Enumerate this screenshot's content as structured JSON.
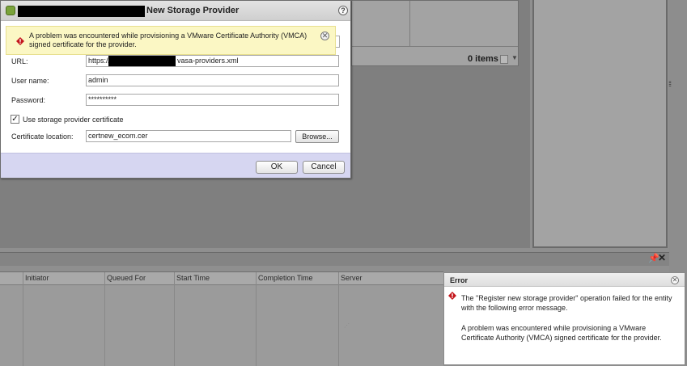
{
  "dialog": {
    "title": "New Storage Provider",
    "help_icon": "help-icon",
    "banner": {
      "icon": "error-icon",
      "message": "A problem was encountered while provisioning a VMware Certificate Authority (VMCA) signed certificate for the provider."
    },
    "form": {
      "url_label": "URL:",
      "url_prefix": "https://",
      "url_suffix": "vasa-providers.xml",
      "username_label": "User name:",
      "username_value": "admin",
      "password_label": "Password:",
      "password_value": "**********",
      "use_cert_label": "Use storage provider certificate",
      "use_cert_checked": true,
      "cert_location_label": "Certificate location:",
      "cert_location_value": "certnew_ecom.cer",
      "browse_label": "Browse..."
    },
    "ok_label": "OK",
    "cancel_label": "Cancel"
  },
  "background": {
    "items_count": "0 items",
    "tasks_table": {
      "columns": [
        "Initiator",
        "Queued For",
        "Start Time",
        "Completion Time",
        "Server"
      ]
    }
  },
  "error_popup": {
    "title": "Error",
    "message_1": "The \"Register new storage provider\" operation failed for the entity with the following error message.",
    "message_2": "A problem was encountered while provisioning a VMware Certificate Authority (VMCA) signed certificate for the provider."
  },
  "colors": {
    "banner_bg": "#fbf7c4",
    "footer_bg": "#d6d6f1",
    "error_red": "#c4161c",
    "overlay": "#8f8f8f"
  }
}
